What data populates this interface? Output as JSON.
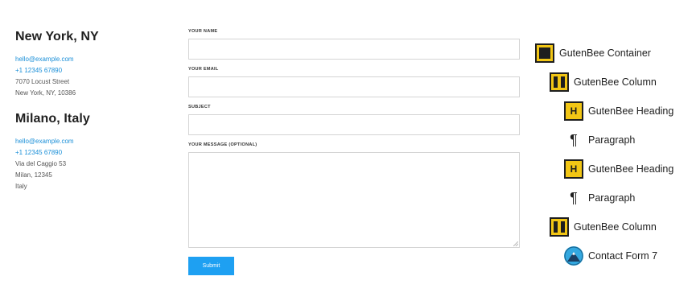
{
  "contacts": [
    {
      "city": "New York, NY",
      "email": "hello@example.com",
      "phone": "+1 12345 67890",
      "address": [
        "7070 Locust Street",
        "New York, NY, 10386"
      ]
    },
    {
      "city": "Milano, Italy",
      "email": "hello@example.com",
      "phone": "+1 12345 67890",
      "address": [
        "Via del Caggio 53",
        "Milan, 12345",
        "Italy"
      ]
    }
  ],
  "form": {
    "name_label": "YOUR NAME",
    "email_label": "YOUR EMAIL",
    "subject_label": "SUBJECT",
    "message_label": "YOUR MESSAGE (OPTIONAL)",
    "submit_label": "Submit"
  },
  "block_tree": [
    {
      "label": "GutenBee Container",
      "icon": "container-icon"
    },
    {
      "label": "GutenBee Column",
      "icon": "columns-icon"
    },
    {
      "label": "GutenBee Heading",
      "icon": "heading-icon"
    },
    {
      "label": "Paragraph",
      "icon": "paragraph-icon"
    },
    {
      "label": "GutenBee Heading",
      "icon": "heading-icon"
    },
    {
      "label": "Paragraph",
      "icon": "paragraph-icon"
    },
    {
      "label": "GutenBee Column",
      "icon": "columns-icon"
    },
    {
      "label": "Contact Form 7",
      "icon": "contact-form-icon"
    }
  ],
  "colors": {
    "link": "#1a8fd8",
    "submit": "#1ea0f2",
    "gutenbee_yellow": "#f2c615",
    "cf7_blue": "#33a8e0"
  },
  "icons": {
    "heading_glyph": "H",
    "paragraph_glyph": "¶"
  }
}
